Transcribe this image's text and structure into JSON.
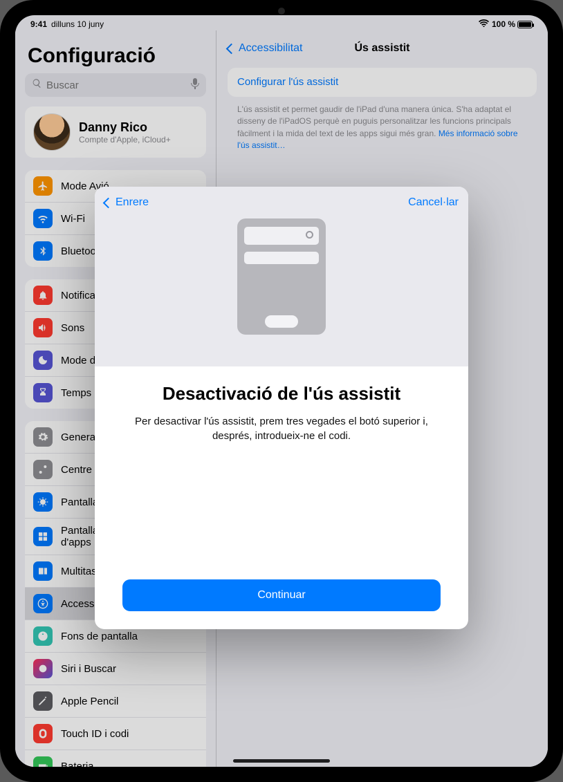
{
  "statusbar": {
    "time": "9:41",
    "date": "dilluns 10 juny",
    "battery_pct": "100 %"
  },
  "sidebar": {
    "title": "Configuració",
    "search_placeholder": "Buscar",
    "profile": {
      "name": "Danny Rico",
      "subtitle": "Compte d'Apple, iCloud+"
    },
    "group1": [
      {
        "label": "Mode Avió"
      },
      {
        "label": "Wi-Fi"
      },
      {
        "label": "Bluetooth"
      }
    ],
    "group2": [
      {
        "label": "Notificacions"
      },
      {
        "label": "Sons"
      },
      {
        "label": "Mode de concentració"
      },
      {
        "label": "Temps d'ús"
      }
    ],
    "group3": [
      {
        "label": "General"
      },
      {
        "label": "Centre de control"
      },
      {
        "label": "Pantalla i brillantor"
      },
      {
        "label": "Pantalla d'inici i biblioteca d'apps"
      },
      {
        "label": "Multitasca i gestos"
      },
      {
        "label": "Accessibilitat"
      },
      {
        "label": "Fons de pantalla"
      },
      {
        "label": "Siri i Buscar"
      },
      {
        "label": "Apple Pencil"
      },
      {
        "label": "Touch ID i codi"
      },
      {
        "label": "Bateria"
      }
    ]
  },
  "detail": {
    "back": "Accessibilitat",
    "title": "Ús assistit",
    "configure_link": "Configurar l'ús assistit",
    "footer": "L'ús assistit et permet gaudir de l'iPad d'una manera única. S'ha adaptat el disseny de l'iPadOS perquè en puguis personalitzar les funcions principals fàcilment i la mida del text de les apps sigui més gran. ",
    "footer_link": "Més informació sobre l'ús assistit…"
  },
  "modal": {
    "back": "Enrere",
    "cancel": "Cancel·lar",
    "heading": "Desactivació de l'ús assistit",
    "body": "Per desactivar l'ús assistit, prem tres vegades el botó superior i, després, introdueix-ne el codi.",
    "continue": "Continuar"
  }
}
